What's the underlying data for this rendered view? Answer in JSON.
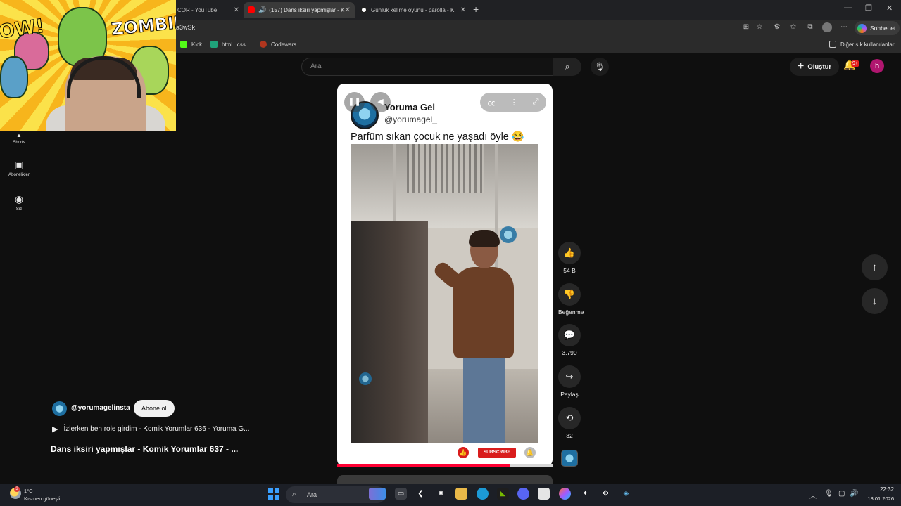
{
  "browser": {
    "tabs": [
      {
        "title": "COR - YouTube",
        "active": false
      },
      {
        "title": "(157) Dans iksiri yapmışlar - K",
        "active": true
      },
      {
        "title": "Günlük kelime oyunu - parolla - K",
        "active": false
      }
    ],
    "new_tab": "+",
    "url": "a3wSk",
    "copilot_label": "Sohbet et",
    "bookmarks": [
      "Kick",
      "html...css...",
      "Codewars"
    ],
    "other_bookmarks": "Diğer sık kullanılanlar"
  },
  "youtube": {
    "search_placeholder": "Ara",
    "create_label": "Oluştur",
    "notification_count": "9+",
    "avatar_letter": "h",
    "guide": [
      {
        "label": "Shorts"
      },
      {
        "label": "Abonelikler"
      },
      {
        "label": "Siz"
      }
    ]
  },
  "webcam_overlay": {
    "text_left": "OW!",
    "text_right": "ZOMBIE!"
  },
  "short": {
    "channel_name": "Yoruma Gel",
    "channel_handle": "@yorumagel_",
    "caption": "Parfüm sıkan çocuk ne yaşadı öyle 😂",
    "subscribe_overlay": "SUBSCRIBE",
    "progress_fraction": 0.8,
    "actions": [
      {
        "name": "like",
        "label": "54 B"
      },
      {
        "name": "dislike",
        "label": "Beğenme"
      },
      {
        "name": "comments",
        "label": "3.790"
      },
      {
        "name": "share",
        "label": "Paylaş"
      },
      {
        "name": "remix",
        "label": "32"
      }
    ]
  },
  "info": {
    "instagram_handle": "@yorumagelinsta",
    "subscribe_label": "Abone ol",
    "playlist_text": "İzlerken ben role girdim - Komik Yorumlar 636 - Yoruma G...",
    "title": "Dans iksiri yapmışlar - Komik Yorumlar 637 - ..."
  },
  "taskbar": {
    "temperature": "1°C",
    "condition": "Kısmen güneşli",
    "weather_badge": "3",
    "search_label": "Ara",
    "time": "22:32",
    "date": "18.01.2026"
  }
}
